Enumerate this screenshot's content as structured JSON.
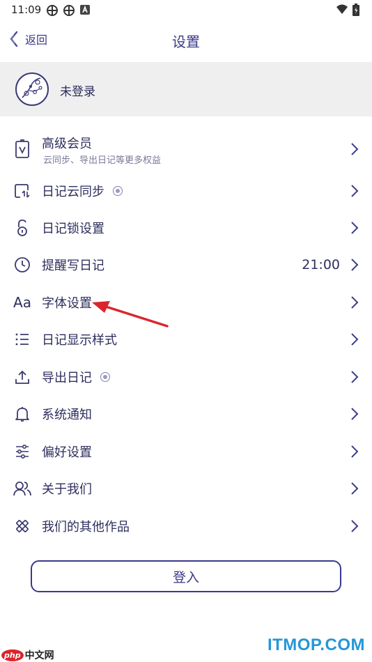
{
  "status_bar": {
    "time": "11:09"
  },
  "nav": {
    "back_label": "返回",
    "title": "设置"
  },
  "profile": {
    "name": "未登录"
  },
  "menu": [
    {
      "id": "vip",
      "label": "高级会员",
      "subtitle": "云同步、导出日记等更多权益",
      "icon": "vip-card-icon"
    },
    {
      "id": "cloud-sync",
      "label": "日记云同步",
      "icon": "cloud-sync-icon",
      "badge": true
    },
    {
      "id": "lock",
      "label": "日记锁设置",
      "icon": "lock-icon"
    },
    {
      "id": "reminder",
      "label": "提醒写日记",
      "icon": "clock-icon",
      "value": "21:00"
    },
    {
      "id": "font",
      "label": "字体设置",
      "icon": "font-icon",
      "icon_text": "Aa"
    },
    {
      "id": "display-style",
      "label": "日记显示样式",
      "icon": "list-icon"
    },
    {
      "id": "export",
      "label": "导出日记",
      "icon": "upload-icon",
      "badge": true
    },
    {
      "id": "notification",
      "label": "系统通知",
      "icon": "bell-icon"
    },
    {
      "id": "preferences",
      "label": "偏好设置",
      "icon": "sliders-icon"
    },
    {
      "id": "about",
      "label": "关于我们",
      "icon": "users-icon"
    },
    {
      "id": "other-works",
      "label": "我们的其他作品",
      "icon": "design-tools-icon"
    }
  ],
  "login_button": "登入",
  "watermarks": {
    "left_logo": "php",
    "left_text": "中文网",
    "right_text": "ITMOP.COM"
  },
  "colors": {
    "primary": "#3a3a8a",
    "profile_bg": "#efefef",
    "arrow": "#d9262c",
    "watermark": "#2596d8"
  }
}
